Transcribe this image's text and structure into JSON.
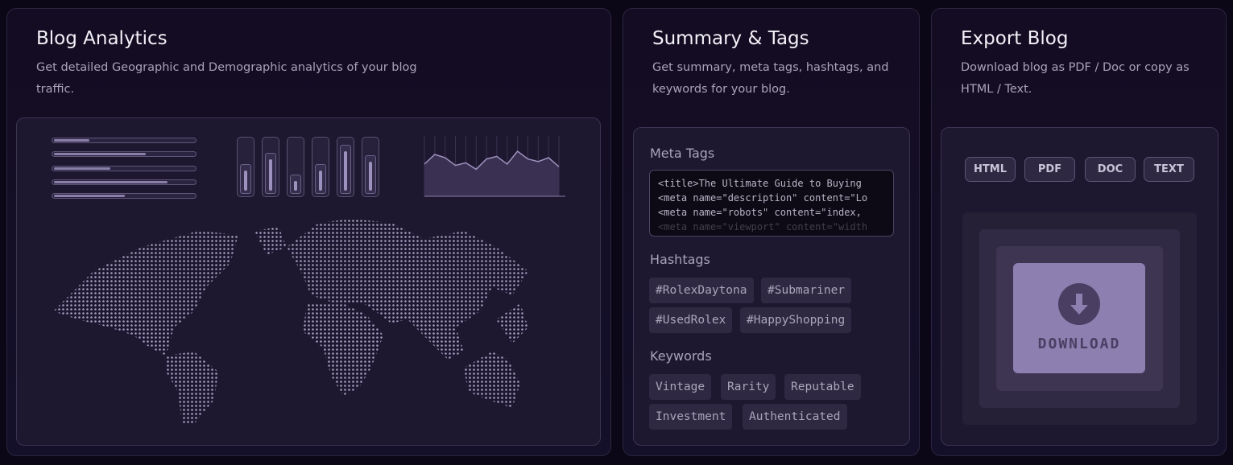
{
  "analytics": {
    "title": "Blog Analytics",
    "description": "Get detailed Geographic and Demographic analytics of your blog traffic.",
    "progress": [
      0.25,
      0.65,
      0.4,
      0.8,
      0.5
    ],
    "bars": [
      0.55,
      0.75,
      0.35,
      0.55,
      0.9,
      0.7
    ],
    "line": [
      5,
      6.5,
      6,
      4.8,
      5.2,
      4.2,
      5.8,
      6.2,
      5,
      7,
      5.8,
      5.4,
      6,
      4.6
    ]
  },
  "summary": {
    "title": "Summary & Tags",
    "description": "Get summary, meta tags, hashtags, and keywords for your blog.",
    "meta_label": "Meta Tags",
    "meta_lines": [
      "<title>The Ultimate Guide to Buying",
      "<meta name=\"description\" content=\"Lo",
      "<meta name=\"robots\" content=\"index,",
      "<meta name=\"viewport\" content=\"width"
    ],
    "hashtags_label": "Hashtags",
    "hashtags": [
      "#RolexDaytona",
      "#Submariner",
      "#UsedRolex",
      "#HappyShopping"
    ],
    "keywords_label": "Keywords",
    "keywords": [
      "Vintage",
      "Rarity",
      "Reputable",
      "Investment",
      "Authenticated"
    ]
  },
  "export": {
    "title": "Export Blog",
    "description": "Download blog as PDF / Doc or copy as HTML / Text.",
    "formats": [
      "HTML",
      "PDF",
      "DOC",
      "TEXT"
    ],
    "download_label": "DOWNLOAD",
    "icon": "download-arrow-icon"
  }
}
